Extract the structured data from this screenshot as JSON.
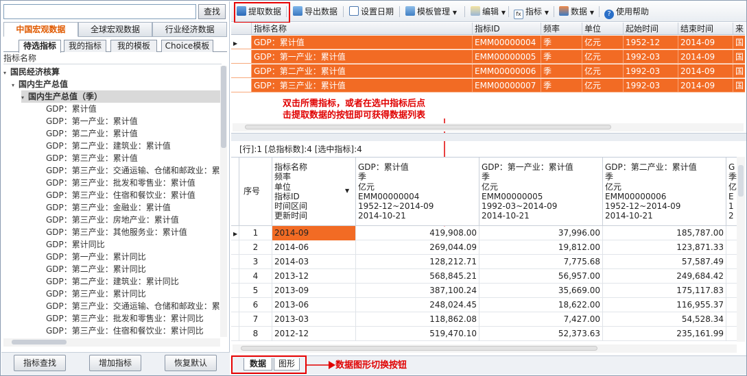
{
  "search": {
    "value": "",
    "button": "查找"
  },
  "category_tabs": [
    "中国宏观数据",
    "全球宏观数据",
    "行业经济数据"
  ],
  "sub_tabs": [
    "待选指标",
    "我的指标",
    "我的模板",
    "Choice模板"
  ],
  "tree_header": "指标名称",
  "tree": [
    {
      "label": "国民经济核算",
      "indent": 0,
      "toggle": "▾",
      "bold": true
    },
    {
      "label": "国内生产总值",
      "indent": 1,
      "toggle": "▾",
      "bold": true
    },
    {
      "label": "国内生产总值（季）",
      "indent": 2,
      "toggle": "▾",
      "bold": true,
      "selected": true
    },
    {
      "label": "GDP：累计值",
      "indent": 3
    },
    {
      "label": "GDP：第一产业：累计值",
      "indent": 3
    },
    {
      "label": "GDP：第二产业：累计值",
      "indent": 3
    },
    {
      "label": "GDP：第二产业：建筑业：累计值",
      "indent": 3
    },
    {
      "label": "GDP：第三产业：累计值",
      "indent": 3
    },
    {
      "label": "GDP：第三产业：交通运输、仓储和邮政业：累",
      "indent": 3
    },
    {
      "label": "GDP：第三产业：批发和零售业：累计值",
      "indent": 3
    },
    {
      "label": "GDP：第三产业：住宿和餐饮业：累计值",
      "indent": 3
    },
    {
      "label": "GDP：第三产业：金融业：累计值",
      "indent": 3
    },
    {
      "label": "GDP：第三产业：房地产业：累计值",
      "indent": 3
    },
    {
      "label": "GDP：第三产业：其他服务业：累计值",
      "indent": 3
    },
    {
      "label": "GDP：累计同比",
      "indent": 3
    },
    {
      "label": "GDP：第一产业：累计同比",
      "indent": 3
    },
    {
      "label": "GDP：第二产业：累计同比",
      "indent": 3
    },
    {
      "label": "GDP：第二产业：建筑业：累计同比",
      "indent": 3
    },
    {
      "label": "GDP：第三产业：累计同比",
      "indent": 3
    },
    {
      "label": "GDP：第三产业：交通运输、仓储和邮政业：累",
      "indent": 3
    },
    {
      "label": "GDP：第三产业：批发和零售业：累计同比",
      "indent": 3
    },
    {
      "label": "GDP：第三产业：住宿和餐饮业：累计同比",
      "indent": 3
    }
  ],
  "left_buttons": [
    "指标查找",
    "增加指标",
    "恢复默认"
  ],
  "toolbar": {
    "fetch": "提取数据",
    "export": "导出数据",
    "set_date": "设置日期",
    "template": "模板管理",
    "edit": "编辑",
    "indicator": "指标",
    "data": "数据",
    "help": "使用帮助"
  },
  "upper_grid": {
    "headers": [
      "指标名称",
      "指标ID",
      "频率",
      "单位",
      "起始时间",
      "结束时间",
      "来"
    ],
    "rows": [
      [
        "GDP：累计值",
        "EMM00000004",
        "季",
        "亿元",
        "1952-12",
        "2014-09",
        "国"
      ],
      [
        "GDP：第一产业：累计值",
        "EMM00000005",
        "季",
        "亿元",
        "1992-03",
        "2014-09",
        "国"
      ],
      [
        "GDP：第二产业：累计值",
        "EMM00000006",
        "季",
        "亿元",
        "1992-03",
        "2014-09",
        "国"
      ],
      [
        "GDP：第三产业：累计值",
        "EMM00000007",
        "季",
        "亿元",
        "1992-03",
        "2014-09",
        "国"
      ]
    ]
  },
  "annotation_top": "双击所需指标，或者在选中指标后点\n击提取数据的按钮即可获得数据列表",
  "status": "[行]:1  [总指标数]:4  [选中指标]:4",
  "lower_grid": {
    "seq_header": "序号",
    "label_header": "指标名称\n频率\n单位\n指标ID\n时间区间\n更新时间",
    "columns": [
      "GDP：累计值\n季\n亿元\nEMM00000004\n1952-12~2014-09\n2014-10-21",
      "GDP：第一产业：累计值\n季\n亿元\nEMM00000005\n1992-03~2014-09\n2014-10-21",
      "GDP：第二产业：累计值\n季\n亿元\nEMM00000006\n1952-12~2014-09\n2014-10-21",
      "G\n季\n亿\nE\n1\n2"
    ],
    "rows": [
      [
        "1",
        "2014-09",
        "419,908.00",
        "37,996.00",
        "185,787.00"
      ],
      [
        "2",
        "2014-06",
        "269,044.09",
        "19,812.00",
        "123,871.33"
      ],
      [
        "3",
        "2014-03",
        "128,212.71",
        "7,775.68",
        "57,587.49"
      ],
      [
        "4",
        "2013-12",
        "568,845.21",
        "56,957.00",
        "249,684.42"
      ],
      [
        "5",
        "2013-09",
        "387,100.24",
        "35,669.00",
        "175,117.83"
      ],
      [
        "6",
        "2013-06",
        "248,024.45",
        "18,622.00",
        "116,955.37"
      ],
      [
        "7",
        "2013-03",
        "118,862.08",
        "7,427.00",
        "54,528.34"
      ],
      [
        "8",
        "2012-12",
        "519,470.10",
        "52,373.63",
        "235,161.99"
      ]
    ]
  },
  "bottom_tabs": [
    "数据",
    "图形"
  ],
  "annotation_bottom": "数据图形切换按钮",
  "colors": {
    "highlight": "#f26b24",
    "annotation": "#e00000"
  }
}
